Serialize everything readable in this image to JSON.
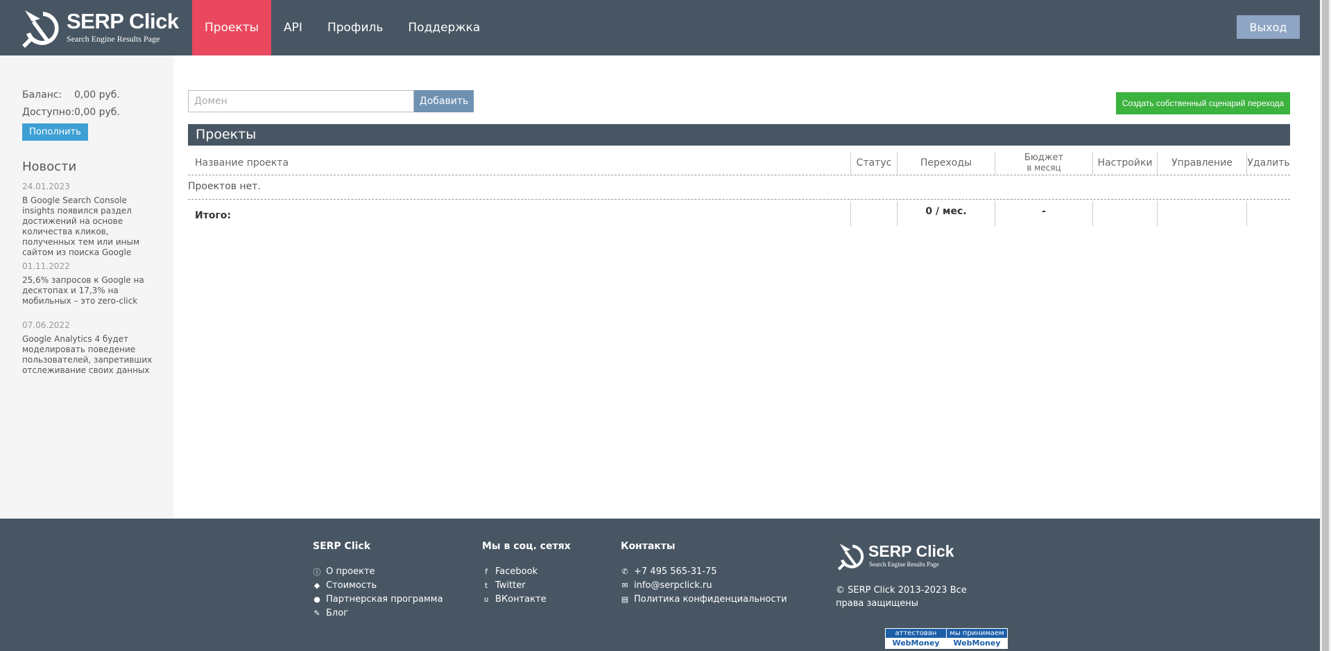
{
  "header": {
    "logo_title": "SERP Click",
    "logo_subtitle": "Search Engine Results Page",
    "nav": [
      {
        "label": "Проекты",
        "active": true
      },
      {
        "label": "API"
      },
      {
        "label": "Профиль"
      },
      {
        "label": "Поддержка"
      }
    ],
    "logout_label": "Выход"
  },
  "sidebar": {
    "balance_label": "Баланс:",
    "balance_value": "0,00 руб.",
    "available_label": "Доступно:",
    "available_value": "0,00 руб.",
    "topup_label": "Пополнить",
    "news_title": "Новости",
    "news": [
      {
        "date": "24.01.2023",
        "text": "В Google Search Console insights появился раздел достижений на основе количества кликов, полученных тем или иным сайтом из поиска Google"
      },
      {
        "date": "01.11.2022",
        "text": "25,6% запросов к Google на десктопах и 17,3% на мобильных – это zero-click"
      },
      {
        "date": "07.06.2022",
        "text": "Google Analytics 4 будет моделировать поведение пользователей, запретивших отслеживание своих данных"
      }
    ]
  },
  "main": {
    "domain_placeholder": "Домен",
    "add_label": "Добавить",
    "scenario_label": "Создать собственный сценарий перехода",
    "projects_title": "Проекты",
    "columns": {
      "name": "Название проекта",
      "status": "Статус",
      "clicks": "Переходы",
      "budget_line1": "Бюджет",
      "budget_line2": "в месяц",
      "settings": "Настройки",
      "manage": "Управление",
      "delete": "Удалить"
    },
    "empty_text": "Проектов нет.",
    "total_label": "Итого:",
    "total_clicks": "0 / мес.",
    "total_budget": "-"
  },
  "footer": {
    "col1_title": "SERP Click",
    "col1_links": [
      "О проекте",
      "Стоимость",
      "Партнерская программа",
      "Блог"
    ],
    "col2_title": "Мы в соц. сетях",
    "col2_links": [
      "Facebook",
      "Twitter",
      "ВКонтакте"
    ],
    "col3_title": "Контакты",
    "col3_links": [
      "+7 495 565-31-75",
      "info@serpclick.ru",
      "Политика конфиденциальности"
    ],
    "logo_title": "SERP Click",
    "logo_subtitle": "Search Engine Results Page",
    "copyright": "© SERP Click 2013-2023 Все права защищены",
    "wm_left_top": "аттестован",
    "wm_left_bottom": "WebMoney",
    "wm_right_top": "мы принимаем",
    "wm_right_bottom": "WebMoney"
  },
  "colors": {
    "header_bg": "#485663",
    "active_nav": "#e9485e",
    "green_button": "#3cb23f",
    "blue_button": "#3d9fd4"
  }
}
